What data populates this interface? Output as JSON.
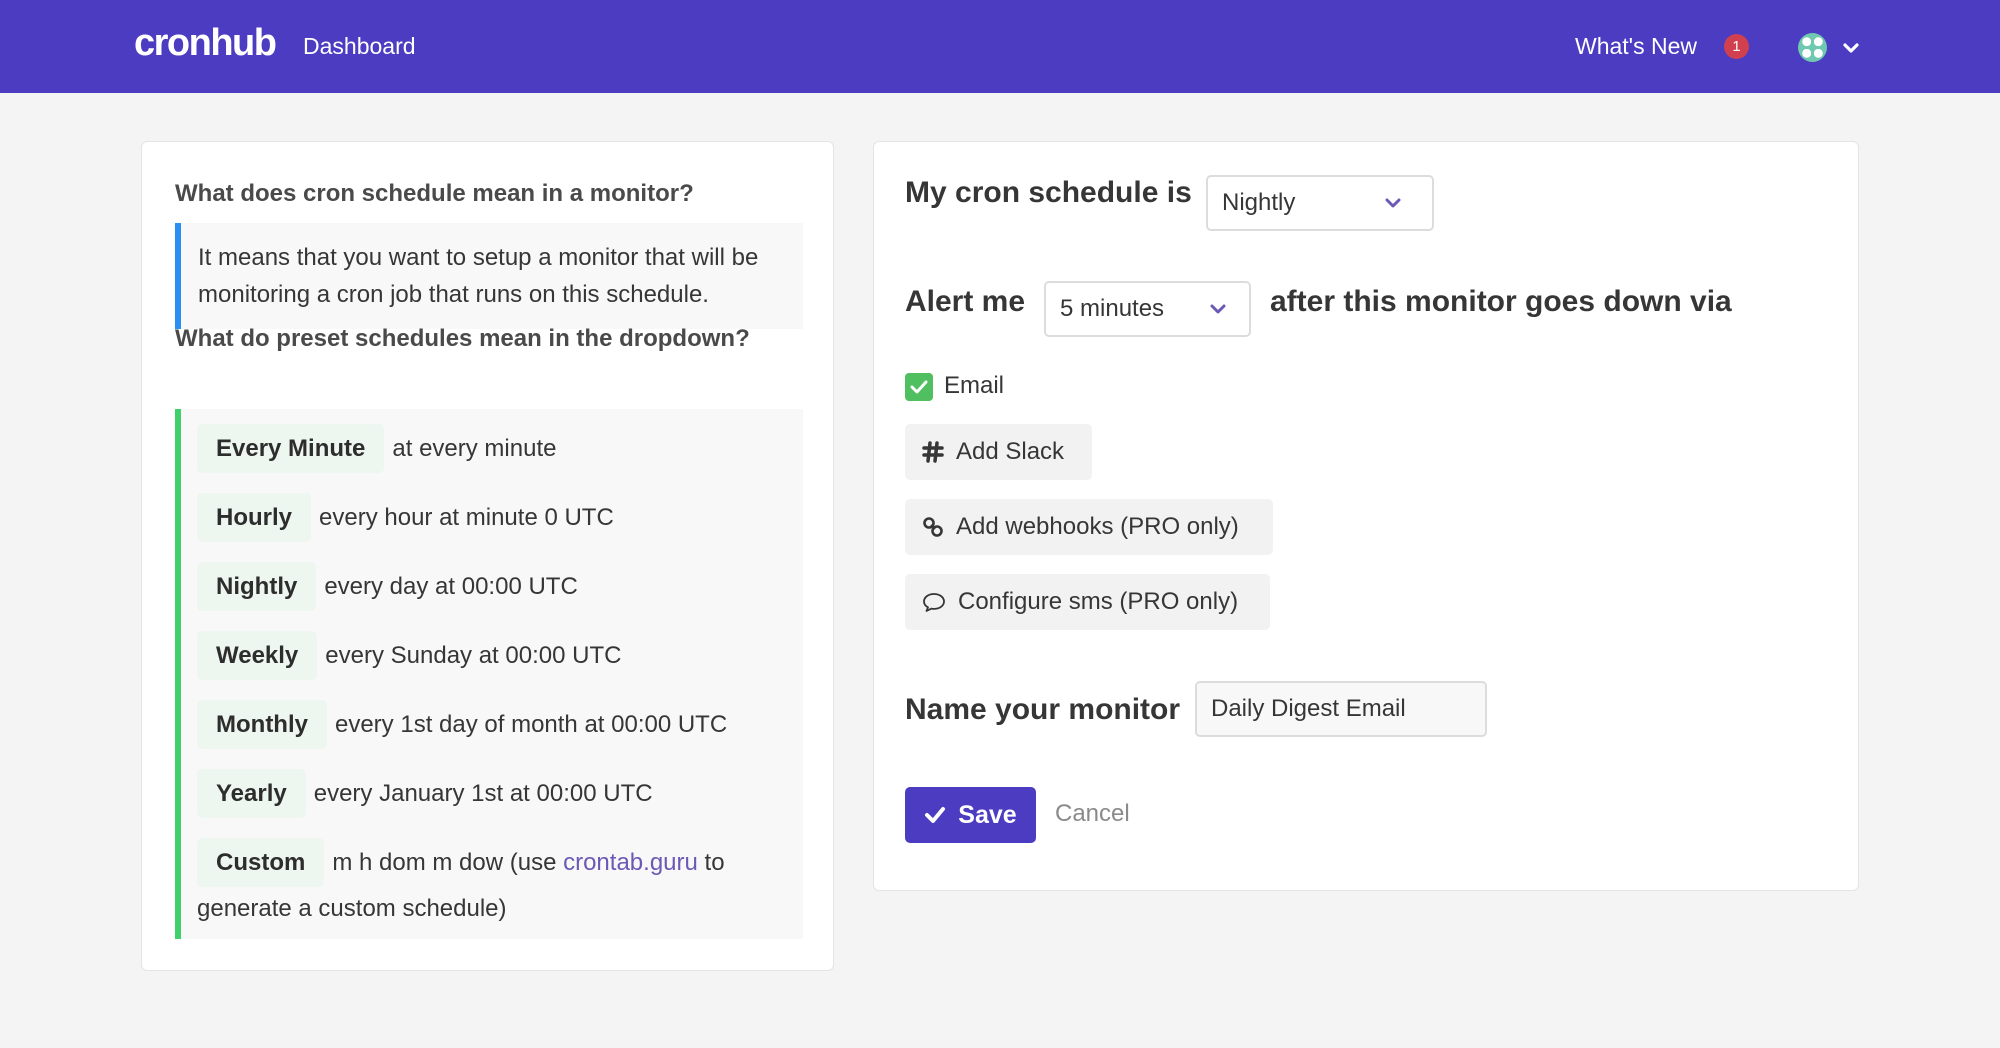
{
  "nav": {
    "logo": "cronhub",
    "dashboard": "Dashboard",
    "whats_new": "What's New",
    "whats_new_badge": "1"
  },
  "help": {
    "q1": "What does cron schedule mean in a monitor?",
    "a1": "It means that you want to setup a monitor that will be monitoring a cron job that runs on this schedule.",
    "q2": "What do preset schedules mean in the dropdown?",
    "presets": [
      {
        "name": "Every Minute",
        "desc": "at every minute"
      },
      {
        "name": "Hourly",
        "desc": "every hour at minute 0 UTC"
      },
      {
        "name": "Nightly",
        "desc": "every day at 00:00 UTC"
      },
      {
        "name": "Weekly",
        "desc": "every Sunday at 00:00 UTC"
      },
      {
        "name": "Monthly",
        "desc": "every 1st day of month at 00:00 UTC"
      },
      {
        "name": "Yearly",
        "desc": "every January 1st at 00:00 UTC"
      }
    ],
    "custom": {
      "name": "Custom",
      "desc_before": "m h dom m dow (use ",
      "link": "crontab.guru",
      "desc_after": " to generate a custom schedule)"
    }
  },
  "form": {
    "schedule_label": "My cron schedule is",
    "schedule_value": "Nightly",
    "alert_label": "Alert me",
    "alert_value": "5 minutes",
    "alert_suffix": "after this monitor goes down via",
    "email_label": "Email",
    "email_checked": true,
    "add_slack": "Add Slack",
    "add_webhooks": "Add webhooks (PRO only)",
    "configure_sms": "Configure sms (PRO only)",
    "name_label": "Name your monitor",
    "name_value": "Daily Digest Email",
    "save": "Save",
    "cancel": "Cancel"
  },
  "colors": {
    "brand": "#4b3cc2",
    "badge": "#d0404f",
    "info_border": "#2a8ff0",
    "success_border": "#3fd06b",
    "checkbox": "#4fbf5f",
    "link": "#6b59b5"
  }
}
